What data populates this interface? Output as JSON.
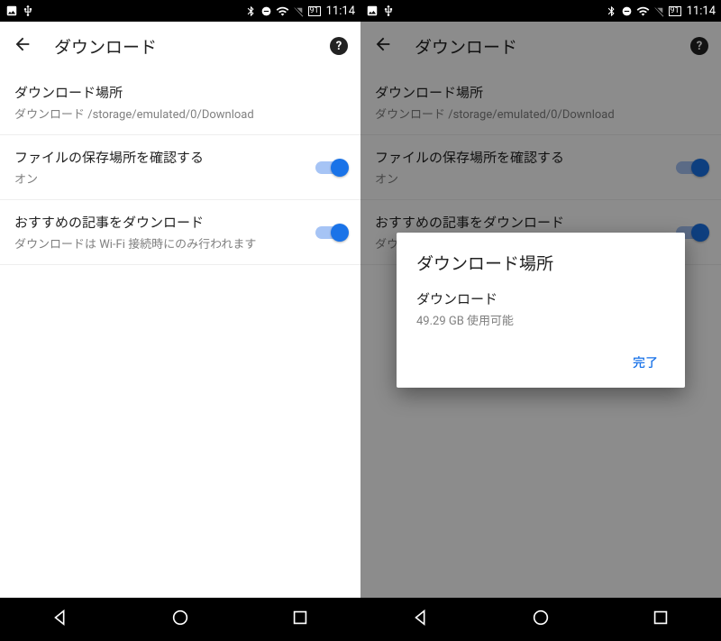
{
  "statusbar": {
    "battery": "91",
    "time": "11:14"
  },
  "header": {
    "title": "ダウンロード"
  },
  "settings": {
    "location": {
      "title": "ダウンロード場所",
      "subtitle": "ダウンロード /storage/emulated/0/Download"
    },
    "confirm": {
      "title": "ファイルの保存場所を確認する",
      "subtitle": "オン"
    },
    "articles": {
      "title": "おすすめの記事をダウンロード",
      "subtitle": "ダウンロードは Wi-Fi 接続時にのみ行われます"
    }
  },
  "dialog": {
    "title": "ダウンロード場所",
    "option_label": "ダウンロード",
    "option_sub": "49.29 GB 使用可能",
    "done": "完了"
  }
}
